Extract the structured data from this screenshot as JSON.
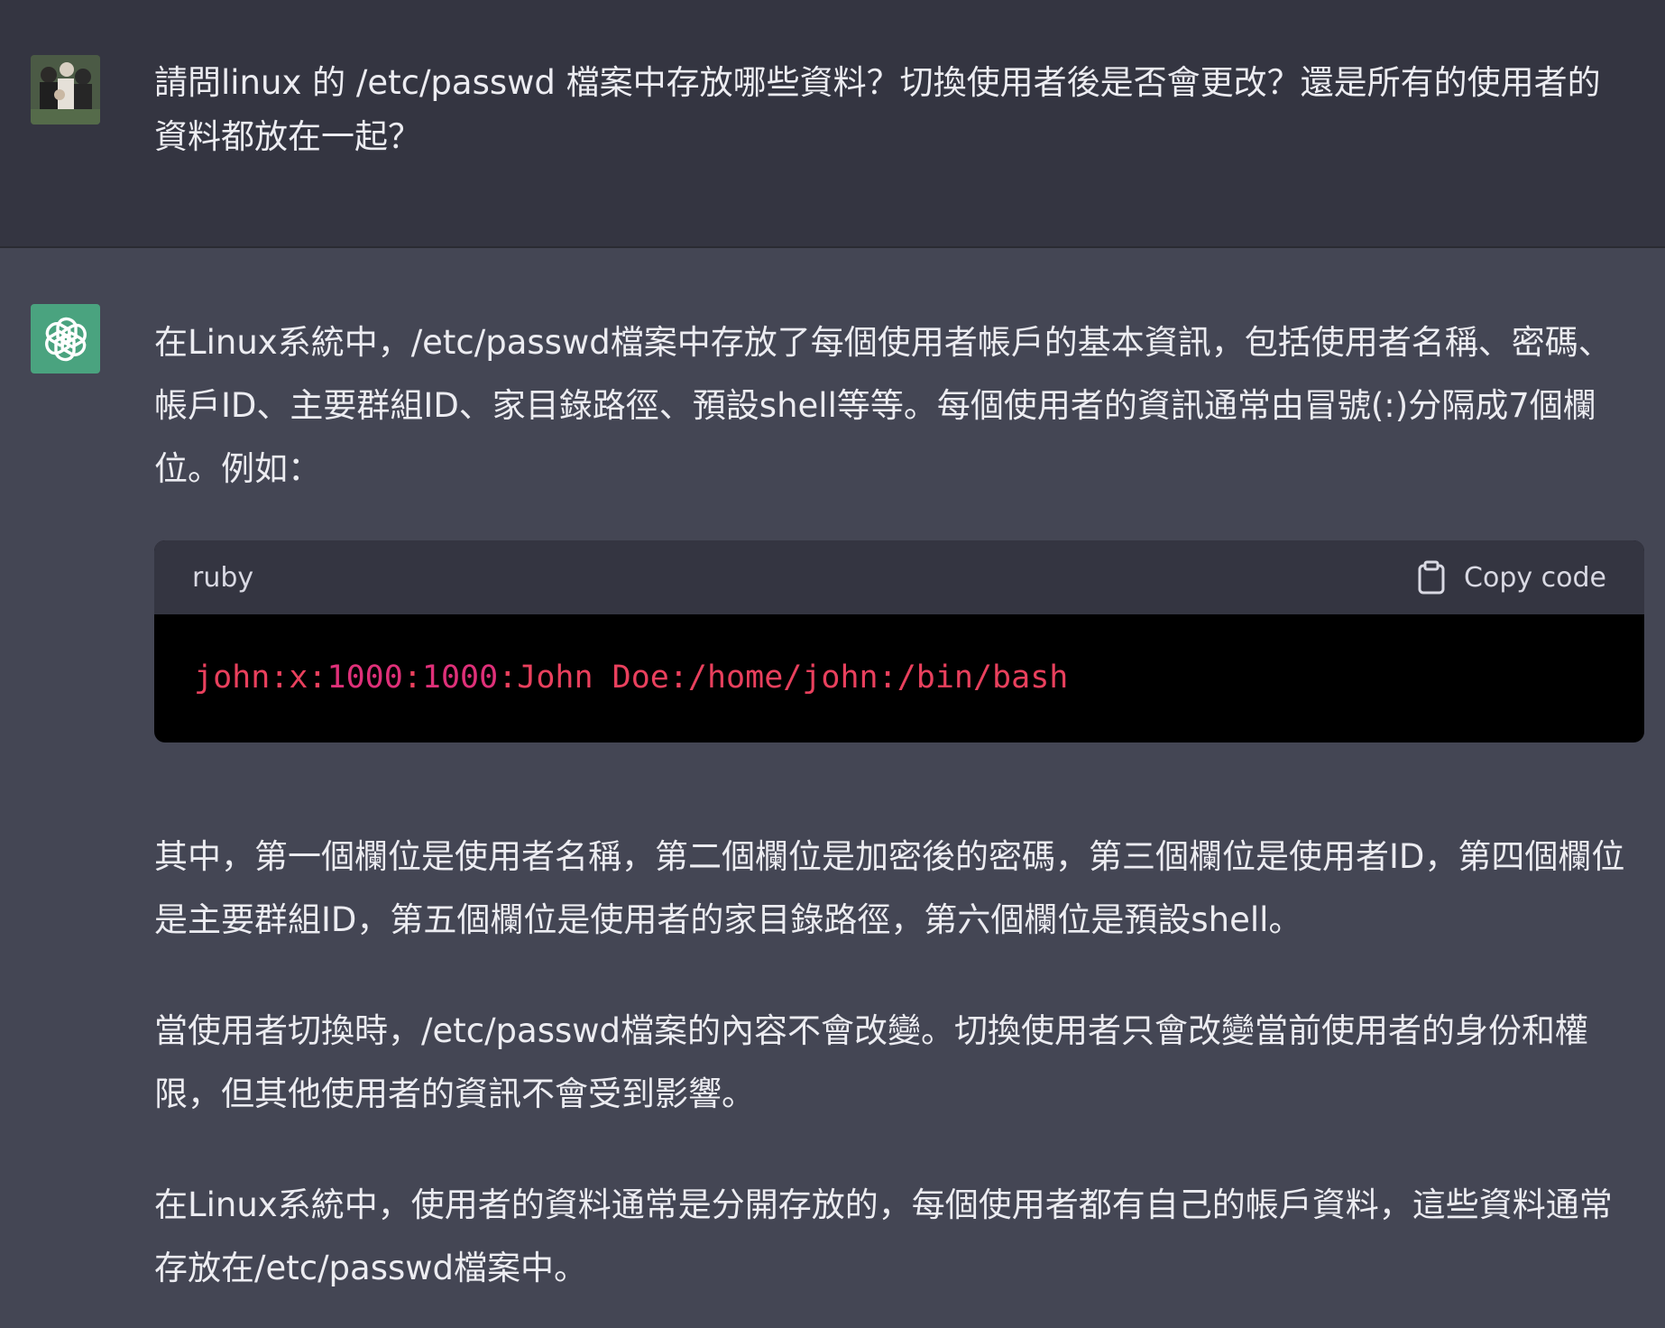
{
  "user_message": {
    "text": "請問linux 的 /etc/passwd 檔案中存放哪些資料？切換使用者後是否會更改？還是所有的使用者的資料都放在一起？"
  },
  "assistant_message": {
    "paragraph_1": "在Linux系統中，/etc/passwd檔案中存放了每個使用者帳戶的基本資訊，包括使用者名稱、密碼、帳戶ID、主要群組ID、家目錄路徑、預設shell等等。每個使用者的資訊通常由冒號(:)分隔成7個欄位。例如：",
    "code_block": {
      "language": "ruby",
      "copy_label": "Copy code",
      "code_part_1": "john:x:",
      "code_part_2": "1000",
      "code_part_3": ":",
      "code_part_4": "1000",
      "code_part_5": ":John Doe:/home/john:/bin/bash"
    },
    "paragraph_2": "其中，第一個欄位是使用者名稱，第二個欄位是加密後的密碼，第三個欄位是使用者ID，第四個欄位是主要群組ID，第五個欄位是使用者的家目錄路徑，第六個欄位是預設shell。",
    "paragraph_3": "當使用者切換時，/etc/passwd檔案的內容不會改變。切換使用者只會改變當前使用者的身份和權限，但其他使用者的資訊不會受到影響。",
    "paragraph_4": "在Linux系統中，使用者的資料通常是分開存放的，每個使用者都有自己的帳戶資料，這些資料通常存放在/etc/passwd檔案中。"
  },
  "colors": {
    "user_bg": "#343541",
    "assistant_bg": "#444654",
    "code_bg": "#000000",
    "code_string": "#e9405d",
    "code_number": "#df3079",
    "bot_avatar_bg": "#4aa37f"
  },
  "icons": {
    "user_avatar": "user-photo-avatar",
    "bot_avatar": "openai-logo-icon",
    "copy": "clipboard-icon"
  }
}
